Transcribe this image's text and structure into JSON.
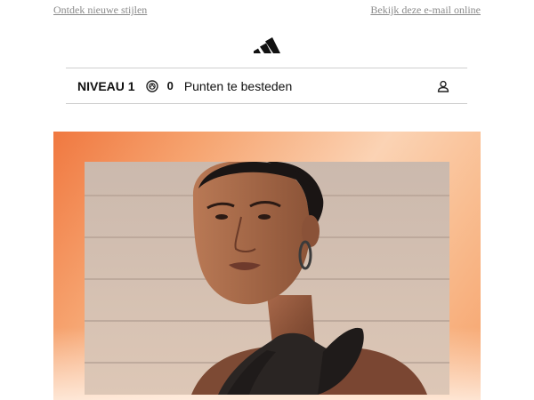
{
  "header": {
    "left_link": "Ontdek nieuwe stijlen",
    "right_link": "Bekijk deze e-mail online",
    "logo_icon": "adidas-logo-icon"
  },
  "member_bar": {
    "level": "NIVEAU 1",
    "points": "0",
    "points_label": "Punten te besteden",
    "coin_icon": "points-coin-icon",
    "user_icon": "user-account-icon"
  },
  "hero": {
    "image": "portrait-woman-photo",
    "background_colors": [
      "#f07840",
      "#fbd3b4",
      "#f6a26a"
    ]
  }
}
